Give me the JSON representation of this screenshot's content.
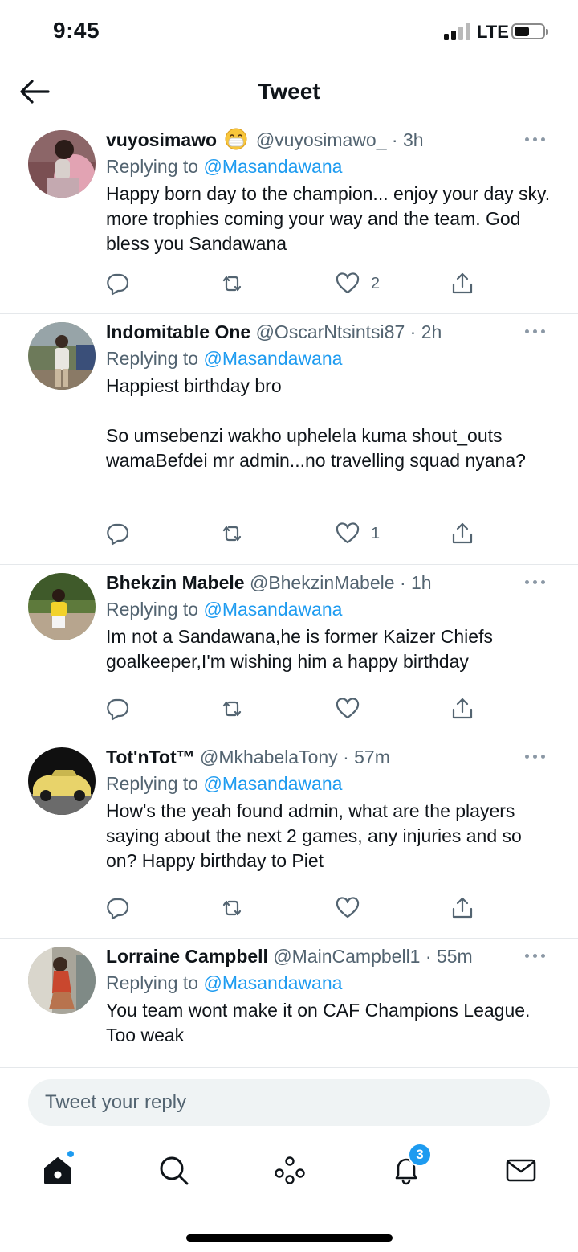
{
  "status_bar": {
    "time": "9:45",
    "network": "LTE"
  },
  "header": {
    "title": "Tweet"
  },
  "replying_prefix": "Replying to",
  "tweets": [
    {
      "name": "vuyosimawo",
      "emoji": "face-with-medical-mask",
      "handle": "@vuyosimawo_",
      "time": "3h",
      "reply_to": "@Masandawana",
      "text": "Happy born day to the champion... enjoy your day sky. more trophies coming your way and the team. God bless you Sandawana",
      "likes": "2"
    },
    {
      "name": "Indomitable One",
      "handle": "@OscarNtsintsi87",
      "time": "2h",
      "reply_to": "@Masandawana",
      "text": "Happiest birthday bro\n\nSo umsebenzi wakho uphelela kuma shout_outs wamaBefdei mr admin...no travelling squad nyana?",
      "likes": "1"
    },
    {
      "name": "Bhekzin Mabele",
      "handle": "@BhekzinMabele",
      "time": "1h",
      "reply_to": "@Masandawana",
      "text": "Im not a Sandawana,he is former Kaizer Chiefs goalkeeper,I'm wishing him a happy birthday",
      "likes": ""
    },
    {
      "name": "Tot'nTot™",
      "handle": "@MkhabelaTony",
      "time": "57m",
      "reply_to": "@Masandawana",
      "text": "How's the yeah found admin, what are the players saying about the next 2 games, any injuries and so on? Happy birthday to Piet",
      "likes": ""
    },
    {
      "name": "Lorraine Campbell",
      "handle": "@MainCampbell1",
      "time": "55m",
      "reply_to": "@Masandawana",
      "text": "You team wont make it on CAF Champions League. Too weak",
      "likes": ""
    }
  ],
  "reply_box": {
    "placeholder": "Tweet your reply"
  },
  "tab_bar": {
    "notifications_badge": "3"
  },
  "colors": {
    "accent": "#1d9bf0",
    "secondary_text": "#536471",
    "divider": "#e5e8eb"
  }
}
